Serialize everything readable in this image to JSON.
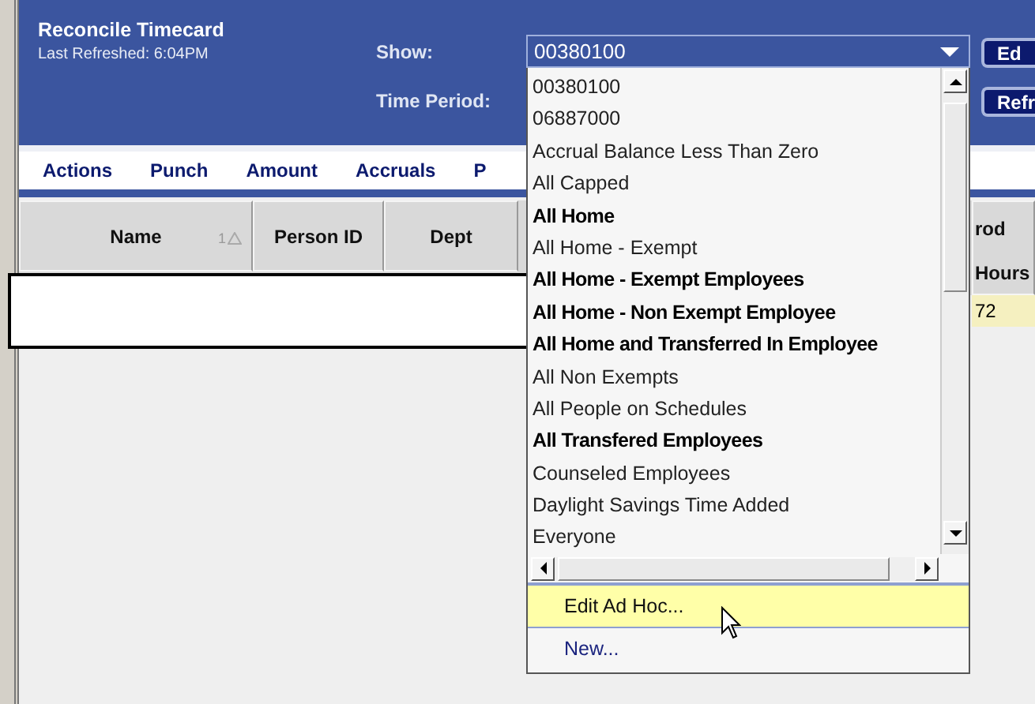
{
  "header": {
    "title": "Reconcile Timecard",
    "subtitle": "Last Refreshed: 6:04PM",
    "show_label": "Show:",
    "time_period_label": "Time Period:",
    "buttons": [
      "Ed",
      "Refr"
    ]
  },
  "menu": [
    "Actions",
    "Punch",
    "Amount",
    "Accruals",
    "P"
  ],
  "table": {
    "columns": [
      {
        "label": "Name",
        "sort_order": "1"
      },
      {
        "label": "Person ID"
      },
      {
        "label": "Dept"
      },
      {
        "group_label": "rod",
        "label": "Hours"
      }
    ],
    "rows": [
      {
        "column_4": "72"
      }
    ]
  },
  "show_dropdown": {
    "value": "00380100",
    "expanded": true,
    "options": [
      {
        "label": "00380100",
        "bold": false
      },
      {
        "label": "06887000",
        "bold": false
      },
      {
        "label": "Accrual Balance Less Than Zero",
        "bold": false
      },
      {
        "label": "All Capped",
        "bold": false
      },
      {
        "label": "All Home",
        "bold": true
      },
      {
        "label": "All Home - Exempt",
        "bold": false
      },
      {
        "label": "All Home - Exempt Employees",
        "bold": true
      },
      {
        "label": "All Home - Non Exempt Employee",
        "bold": true
      },
      {
        "label": "All Home and Transferred In Employee",
        "bold": true
      },
      {
        "label": "All Non Exempts",
        "bold": false
      },
      {
        "label": "All People on Schedules",
        "bold": false
      },
      {
        "label": "All Transfered Employees",
        "bold": true
      },
      {
        "label": "Counseled Employees",
        "bold": false
      },
      {
        "label": "Daylight Savings Time Added",
        "bold": false
      },
      {
        "label": "Everyone",
        "bold": false
      }
    ],
    "actions": [
      {
        "label": "Edit Ad Hoc...",
        "hovered": true
      },
      {
        "label": "New...",
        "hovered": false
      }
    ]
  }
}
